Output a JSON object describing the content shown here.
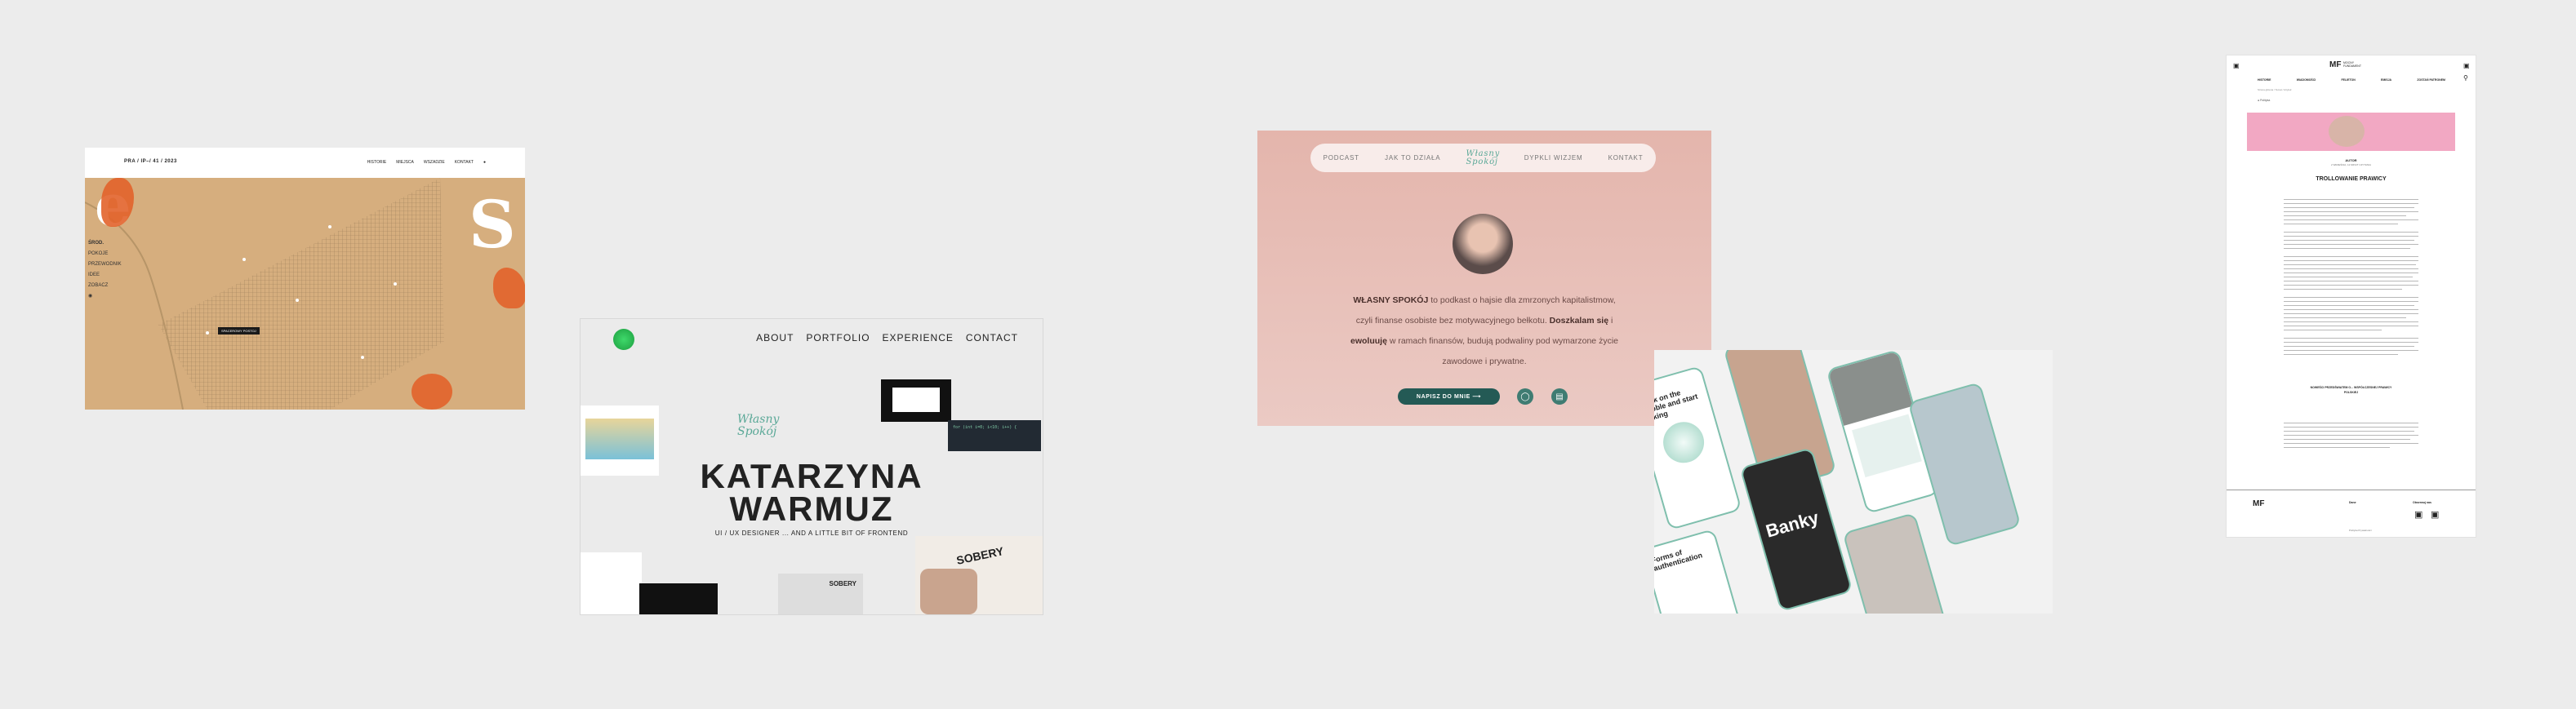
{
  "map_site": {
    "brand": "PRA / IP–/ 41 / 2023",
    "nav": [
      "HISTORIE",
      "MIEJSCA",
      "WSZADZIE",
      "KONTAKT"
    ],
    "side_menu": [
      "ŚROD.",
      "POKOJE",
      "PRZEWODNIK",
      "IDEE",
      "ZOBACZ"
    ],
    "tooltip": "SPACEROWY POSTOJ",
    "big_letters": [
      "e",
      "S"
    ],
    "colors": {
      "map": "#d6ae7e",
      "accent": "#e2632b"
    }
  },
  "portfolio": {
    "nav": [
      "ABOUT",
      "PORTFOLIO",
      "EXPERIENCE",
      "CONTACT"
    ],
    "script": "Własny Spokój",
    "name_line1": "KATARZYNA",
    "name_line2": "WARMUZ",
    "subtitle": "UI / UX DESIGNER ... AND A LITTLE BIT OF FRONTEND",
    "sobery": "SOBERY",
    "code_text": "for (int i=0; i<10; i++) {"
  },
  "podcast": {
    "nav": [
      "PODCAST",
      "JAK TO DZIAŁA",
      "DYPKLI WIZJEM",
      "KONTAKT"
    ],
    "logo_script": "Własny Spokój",
    "text_bold1": "WŁASNY SPOKÓJ",
    "text1": " to podkast o hajsie dla zmrzonych kapitalistmow,",
    "text2": "czyli finanse osobiste bez motywacyjnego bełkotu. ",
    "text_bold2": "Doszkalam się",
    "text3": " i",
    "text_bold3": "ewoluuję",
    "text4": " w ramach finansów, budują podwaliny pod wymarzone życie",
    "text5": "zawodowe i prywatne.",
    "button": "NAPISZ DO MNIE ⟶",
    "icons": [
      "instagram-icon",
      "spotify-icon"
    ]
  },
  "app": {
    "screens": [
      "Click on the bubble and start talking",
      "Banky",
      "Forms of authentication"
    ],
    "brand": "Banky"
  },
  "article": {
    "logo": "MF",
    "logo_text": "MOCNY FUNDAMENT",
    "nav": [
      "HISTORIE",
      "WIADOMOŚCI",
      "FELIETON",
      "EMISJA",
      "ZOSTAŃ PATRONEM"
    ],
    "breadcrumb": "Strona główna / Temat / Artykuł",
    "tag": "● Polityka",
    "author": "AUTOR",
    "meta": "2 WRZEŚNIA, 12 MINUT CZYTANIA",
    "title": "TROLLOWANIE PRAWICY",
    "subheading": "NOWEŚCI PRZEDŚWIATEM O... WSPÓŁCZESNEJ PRAWICY POLSKIEJ",
    "footer_logo": "MF",
    "footer_col": "Dane",
    "footer_social": "Obserwuj nas",
    "footer_meta": [
      "Polityka Prywatności",
      "Regulamin"
    ]
  }
}
